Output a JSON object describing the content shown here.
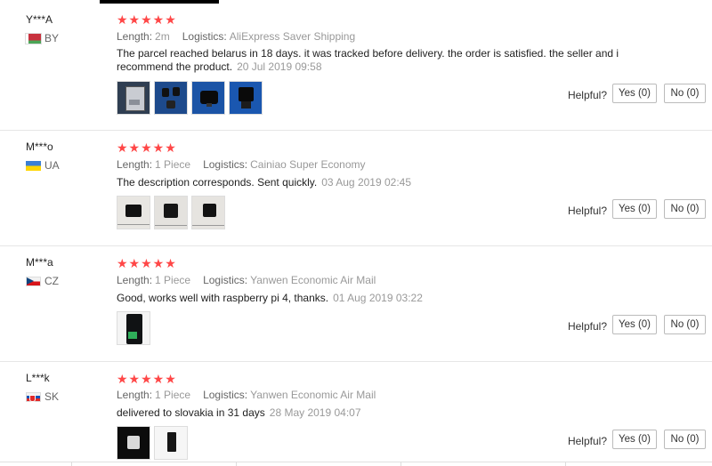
{
  "labels": {
    "length": "Length:",
    "logistics": "Logistics:",
    "helpful": "Helpful?",
    "yes": "Yes (0)",
    "no": "No (0)",
    "stars": "★★★★★"
  },
  "colors": {
    "star": "#ff4747",
    "muted": "#999999",
    "text": "#222222"
  },
  "reviews": [
    {
      "user": "Y***A",
      "country": "BY",
      "rating": 5,
      "length": "2m",
      "logistics": "AliExpress Saver Shipping",
      "text": "The parcel reached belarus in 18 days. it was tracked before delivery. the order is satisfied. the seller and i recommend the product.",
      "date": "20 Jul 2019 09:58",
      "photos": 4
    },
    {
      "user": "M***o",
      "country": "UA",
      "rating": 5,
      "length": "1 Piece",
      "logistics": "Cainiao Super Economy",
      "text": "The description corresponds. Sent quickly.",
      "date": "03 Aug 2019 02:45",
      "photos": 3
    },
    {
      "user": "M***a",
      "country": "CZ",
      "rating": 5,
      "length": "1 Piece",
      "logistics": "Yanwen Economic Air Mail",
      "text": "Good, works well with raspberry pi 4, thanks.",
      "date": "01 Aug 2019 03:22",
      "photos": 1
    },
    {
      "user": "L***k",
      "country": "SK",
      "rating": 5,
      "length": "1 Piece",
      "logistics": "Yanwen Economic Air Mail",
      "text": "delivered to slovakia in 31 days",
      "date": "28 May 2019 04:07",
      "photos": 2
    }
  ]
}
